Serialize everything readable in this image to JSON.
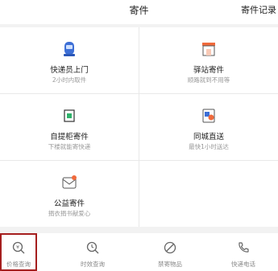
{
  "header": {
    "title": "寄件",
    "records": "寄件记录"
  },
  "services": [
    {
      "name": "快递员上门",
      "desc": "2小时内取件",
      "icon": "courier-icon"
    },
    {
      "name": "驿站寄件",
      "desc": "顺路就到不用等",
      "icon": "station-icon"
    },
    {
      "name": "自提柜寄件",
      "desc": "下楼就能寄快递",
      "icon": "locker-icon"
    },
    {
      "name": "同城直送",
      "desc": "最快1小时送达",
      "icon": "city-delivery-icon"
    },
    {
      "name": "公益寄件",
      "desc": "捐衣捐书献爱心",
      "icon": "charity-icon"
    }
  ],
  "tools": [
    {
      "label": "价格查询",
      "icon": "price-search-icon"
    },
    {
      "label": "时效查询",
      "icon": "time-search-icon"
    },
    {
      "label": "禁寄物品",
      "icon": "prohibited-icon"
    },
    {
      "label": "快递电话",
      "icon": "phone-icon"
    }
  ],
  "colors": {
    "accent_blue": "#3d6fd6",
    "accent_orange": "#f06a3c",
    "highlight_border": "#a51e1e"
  }
}
